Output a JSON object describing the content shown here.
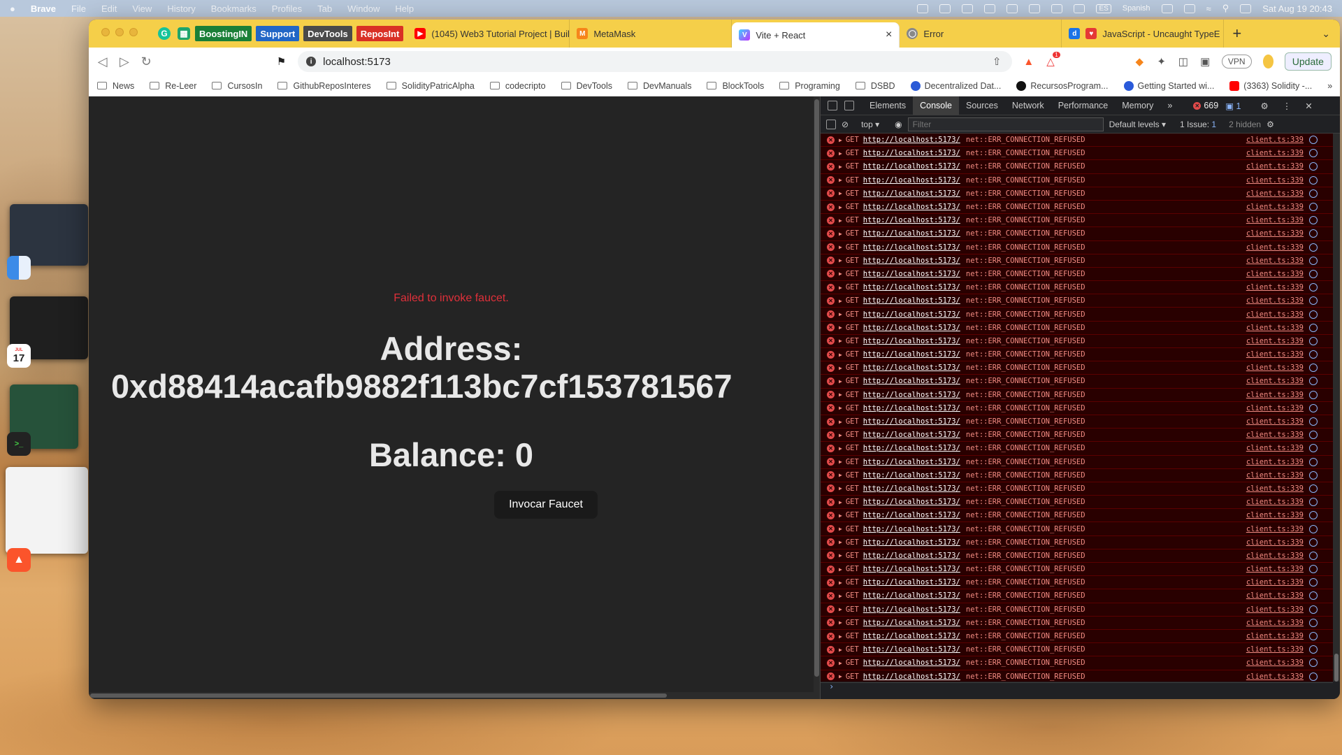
{
  "menubar": {
    "items": [
      "Brave",
      "File",
      "Edit",
      "View",
      "History",
      "Bookmarks",
      "Profiles",
      "Tab",
      "Window",
      "Help"
    ],
    "input_source": "Spanish",
    "kbd_label": "ES",
    "clock": "Sat Aug 19  20:43"
  },
  "dock": {
    "calendar_month": "JUL",
    "calendar_day": "17"
  },
  "tabs": {
    "pinned": [
      {
        "label": "BoostingIN",
        "color": "#1a7f37"
      },
      {
        "label": "Support",
        "color": "#2166c6"
      },
      {
        "label": "DevTools",
        "color": "#4a4a4a"
      },
      {
        "label": "ReposInt",
        "color": "#d93025"
      }
    ],
    "open": [
      {
        "title": "(1045) Web3 Tutorial Project | Build",
        "icon": "youtube-icon"
      },
      {
        "title": "MetaMask",
        "icon": "metamask-icon"
      },
      {
        "title": "Vite + React",
        "icon": "vite-icon",
        "active": true
      },
      {
        "title": "Error",
        "icon": "globe-icon"
      },
      {
        "title": "JavaScript - Uncaught TypeE",
        "icon": "docs-icon"
      }
    ],
    "close_glyph": "×",
    "new_tab_glyph": "+"
  },
  "toolbar": {
    "url": "localhost:5173",
    "vpn_label": "VPN",
    "update_label": "Update",
    "brave_badge": "1"
  },
  "bookmarks": [
    {
      "label": "News",
      "type": "folder"
    },
    {
      "label": "Re-Leer",
      "type": "folder"
    },
    {
      "label": "CursosIn",
      "type": "folder"
    },
    {
      "label": "GithubReposInteres",
      "type": "folder"
    },
    {
      "label": "SolidityPatricAlpha",
      "type": "folder"
    },
    {
      "label": "codecripto",
      "type": "folder"
    },
    {
      "label": "DevTools",
      "type": "folder"
    },
    {
      "label": "DevManuals",
      "type": "folder"
    },
    {
      "label": "BlockTools",
      "type": "folder"
    },
    {
      "label": "Programing",
      "type": "folder"
    },
    {
      "label": "DSBD",
      "type": "folder"
    },
    {
      "label": "Decentralized Dat...",
      "type": "link"
    },
    {
      "label": "RecursosProgram...",
      "type": "link"
    },
    {
      "label": "Getting Started wi...",
      "type": "link"
    },
    {
      "label": "(3363) Solidity -...",
      "type": "link"
    }
  ],
  "page": {
    "error": "Failed to invoke faucet.",
    "address_label": "Address:",
    "address_value": "0xd88414acafb9882f113bc7cf153781567",
    "balance": "Balance: 0",
    "button": "Invocar Faucet"
  },
  "devtools": {
    "tabs": [
      "Elements",
      "Console",
      "Sources",
      "Network",
      "Performance",
      "Memory"
    ],
    "active_tab": "Console",
    "more": "»",
    "error_count": "669",
    "message_count": "1",
    "context": "top",
    "filter_placeholder": "Filter",
    "levels": "Default levels",
    "issues": "1 Issue:",
    "issues_count": "1",
    "hidden": "2 hidden",
    "log_row": {
      "method": "GET",
      "url": "http://localhost:5173/",
      "message": "net::ERR_CONNECTION_REFUSED",
      "source": "client.ts:339"
    },
    "row_count": 41,
    "prompt": "›"
  }
}
